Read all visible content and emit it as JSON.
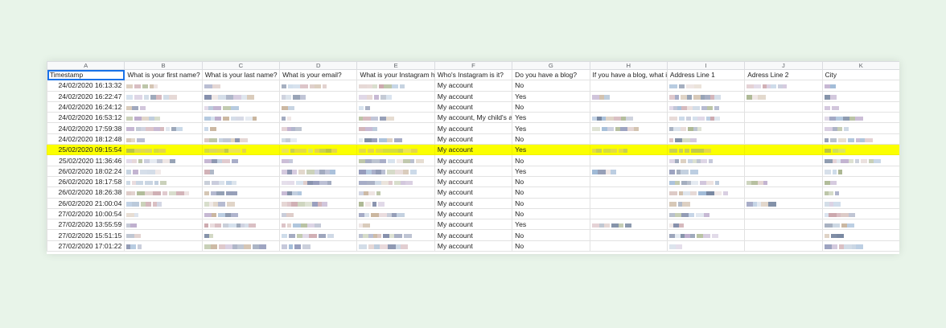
{
  "columns": [
    "A",
    "B",
    "C",
    "D",
    "E",
    "F",
    "G",
    "H",
    "I",
    "J",
    "K"
  ],
  "header_row": [
    "Timestamp",
    "What is your first name?",
    "What is your last name?",
    "What is your email?",
    "What is your Instagram ha",
    "Who's Instagram is it?",
    "Do you have a blog?",
    "If you have a blog, what is",
    "Address Line 1",
    "Adress Line 2",
    "City"
  ],
  "rows": [
    {
      "timestamp": "24/02/2020 16:13:32",
      "instagram_owner": "My account",
      "has_blog": "No",
      "highlight": false
    },
    {
      "timestamp": "24/02/2020 16:22:47",
      "instagram_owner": "My account",
      "has_blog": "Yes",
      "highlight": false
    },
    {
      "timestamp": "24/02/2020 16:24:12",
      "instagram_owner": "My account",
      "has_blog": "No",
      "highlight": false
    },
    {
      "timestamp": "24/02/2020 16:53:12",
      "instagram_owner": "My account, My child's ac",
      "has_blog": "Yes",
      "highlight": false
    },
    {
      "timestamp": "24/02/2020 17:59:38",
      "instagram_owner": "My account",
      "has_blog": "Yes",
      "highlight": false
    },
    {
      "timestamp": "24/02/2020 18:12:48",
      "instagram_owner": "My account",
      "has_blog": "No",
      "highlight": false
    },
    {
      "timestamp": "25/02/2020 09:15:54",
      "instagram_owner": "My account",
      "has_blog": "Yes",
      "highlight": true
    },
    {
      "timestamp": "25/02/2020 11:36:46",
      "instagram_owner": "My account",
      "has_blog": "No",
      "highlight": false
    },
    {
      "timestamp": "26/02/2020 18:02:24",
      "instagram_owner": "My account",
      "has_blog": "Yes",
      "highlight": false
    },
    {
      "timestamp": "26/02/2020 18:17:58",
      "instagram_owner": "My account",
      "has_blog": "No",
      "highlight": false
    },
    {
      "timestamp": "26/02/2020 18:26:38",
      "instagram_owner": "My account",
      "has_blog": "No",
      "highlight": false
    },
    {
      "timestamp": "26/02/2020 21:00:04",
      "instagram_owner": "My account",
      "has_blog": "No",
      "highlight": false
    },
    {
      "timestamp": "27/02/2020 10:00:54",
      "instagram_owner": "My account",
      "has_blog": "No",
      "highlight": false
    },
    {
      "timestamp": "27/02/2020 13:55:59",
      "instagram_owner": "My account",
      "has_blog": "Yes",
      "highlight": false
    },
    {
      "timestamp": "27/02/2020 15:51:15",
      "instagram_owner": "My account",
      "has_blog": "No",
      "highlight": false
    },
    {
      "timestamp": "27/02/2020 17:01:22",
      "instagram_owner": "My account",
      "has_blog": "No",
      "highlight": false
    }
  ],
  "colors": {
    "background": "#e8f4e9",
    "highlight": "#fbff00",
    "selection": "#1a73e8",
    "redaction_palette": [
      "#b9a7c9",
      "#8f96b8",
      "#c7b29a",
      "#9ab6d4",
      "#d9c4c0",
      "#7f8aa8",
      "#b7c7d9",
      "#a7b38c",
      "#c9a3a9",
      "#6f7f9a"
    ]
  }
}
